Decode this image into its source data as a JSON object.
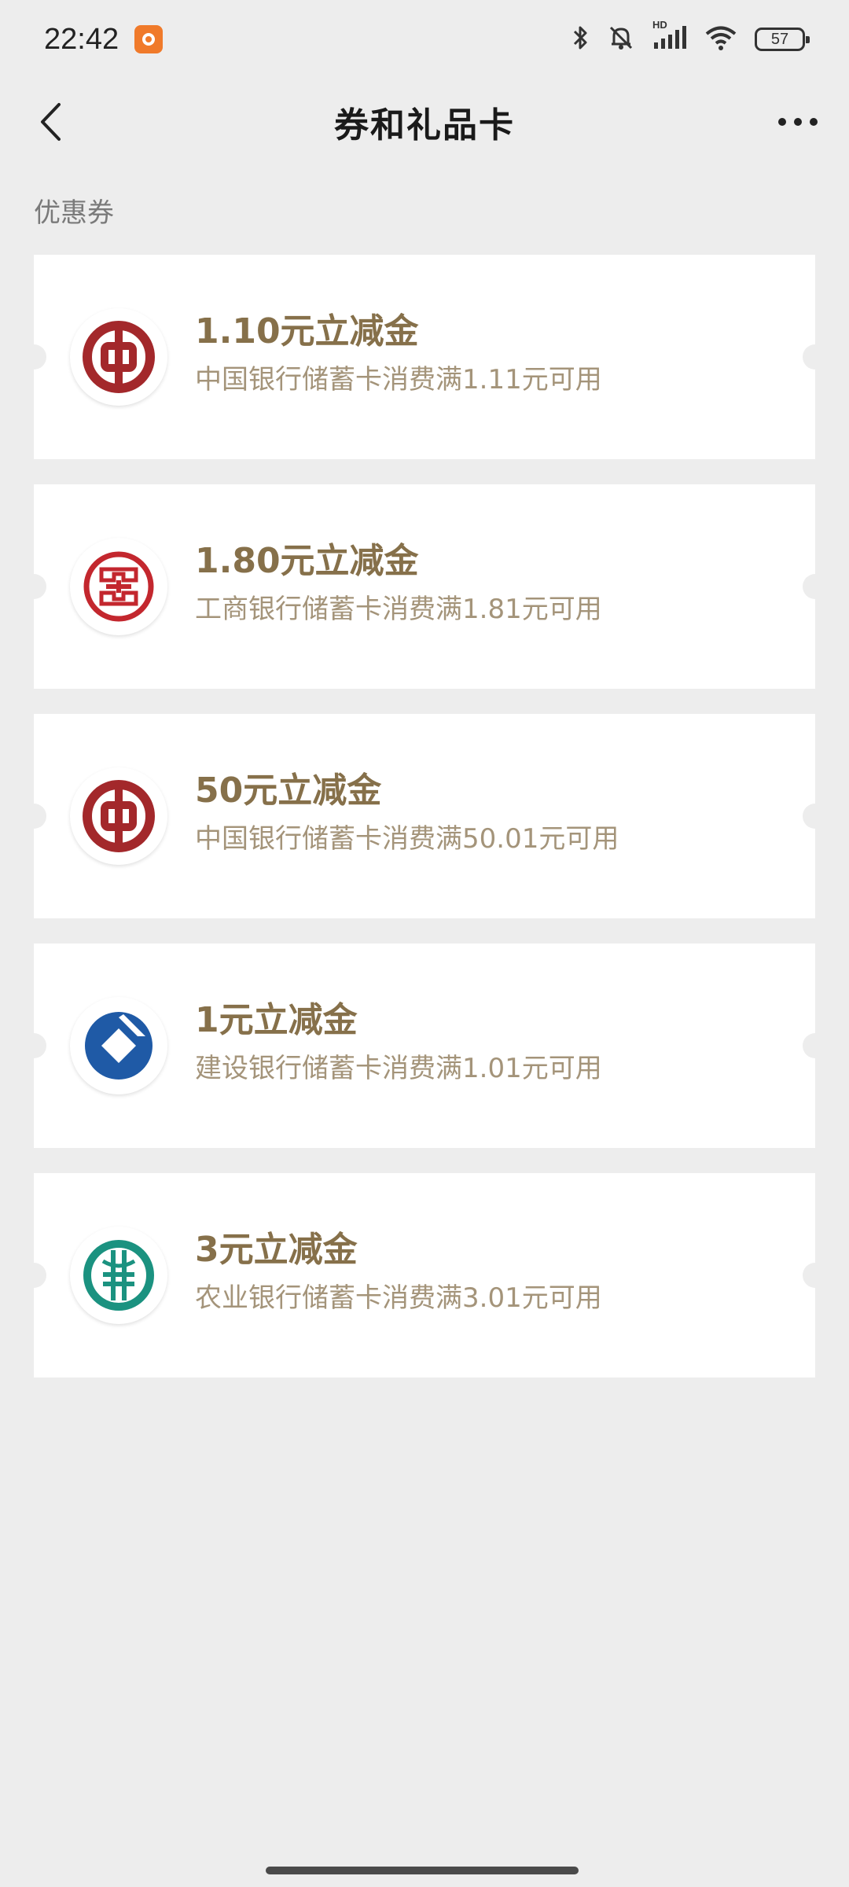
{
  "status_bar": {
    "time": "22:42",
    "battery": "57",
    "hd_label": "HD",
    "icons": [
      "bluetooth-icon",
      "mute-bell-icon",
      "signal-icon",
      "wifi-icon",
      "battery-icon"
    ]
  },
  "nav": {
    "title": "券和礼品卡",
    "back_icon": "chevron-left-icon",
    "more_icon": "more-dots-icon"
  },
  "section_label": "优惠券",
  "coupons": [
    {
      "title": "1.10元立减金",
      "desc": "中国银行储蓄卡消费满1.11元可用",
      "bank_icon": "boc-logo",
      "color": "#a3282b"
    },
    {
      "title": "1.80元立减金",
      "desc": "工商银行储蓄卡消费满1.81元可用",
      "bank_icon": "icbc-logo",
      "color": "#c3272e"
    },
    {
      "title": "50元立减金",
      "desc": "中国银行储蓄卡消费满50.01元可用",
      "bank_icon": "boc-logo",
      "color": "#a3282b"
    },
    {
      "title": "1元立减金",
      "desc": "建设银行储蓄卡消费满1.01元可用",
      "bank_icon": "ccb-logo",
      "color": "#1f5aa6"
    },
    {
      "title": "3元立减金",
      "desc": "农业银行储蓄卡消费满3.01元可用",
      "bank_icon": "abc-logo",
      "color": "#1b9280"
    }
  ],
  "colors": {
    "background": "#ededed",
    "coupon_title": "#86704a",
    "coupon_desc": "#a4947a"
  }
}
